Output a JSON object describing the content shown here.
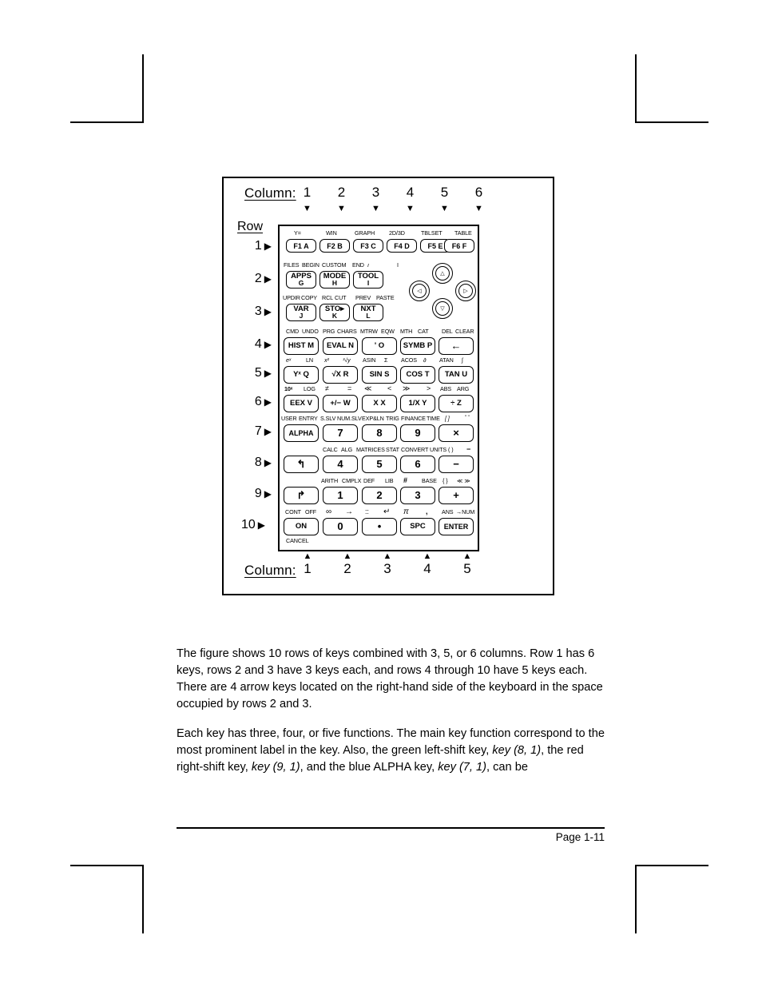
{
  "page": {
    "footer_rule": true,
    "page_number": "Page 1-11"
  },
  "figure": {
    "column_header_label": "Column:",
    "row_header_label": "Row",
    "top_columns": [
      "1",
      "2",
      "3",
      "4",
      "5",
      "6"
    ],
    "bottom_columns": [
      "1",
      "2",
      "3",
      "4",
      "5"
    ],
    "down_arrow_glyph": "▼",
    "up_arrow_glyph": "▲",
    "row_arrow_glyph": "▶",
    "rows": [
      "1",
      "2",
      "3",
      "4",
      "5",
      "6",
      "7",
      "8",
      "9",
      "10"
    ]
  },
  "keyboard": {
    "row1": {
      "top_labels": [
        "Y=",
        "WIN",
        "GRAPH",
        "2D/3D",
        "TBLSET",
        "TABLE"
      ],
      "keys": [
        "F1 A",
        "F2 B",
        "F3 C",
        "F4 D",
        "F5 E",
        "F6 F"
      ]
    },
    "row2": {
      "top_labels": [
        "FILES",
        "BEGIN",
        "CUSTOM",
        "END",
        "ı",
        "I"
      ],
      "keys": [
        {
          "main": "APPS",
          "sub": "G"
        },
        {
          "main": "MODE",
          "sub": "H"
        },
        {
          "main": "TOOL",
          "sub": "I"
        }
      ]
    },
    "row3": {
      "top_labels": [
        "UPDIR",
        "COPY",
        "RCL",
        "CUT",
        "PREV",
        "PASTE"
      ],
      "keys": [
        {
          "main": "VAR",
          "sub": "J"
        },
        {
          "main": "STO▸",
          "sub": "K"
        },
        {
          "main": "NXT",
          "sub": "L"
        }
      ]
    },
    "row4": {
      "top_labels": [
        "CMD",
        "UNDO",
        "PRG",
        "CHARS",
        "MTRW",
        "EQW",
        "MTH",
        "CAT",
        "DEL",
        "CLEAR"
      ],
      "keys": [
        "HIST M",
        "EVAL N",
        "' O",
        "SYMB P",
        "←"
      ]
    },
    "row5": {
      "top_labels": [
        "eˣ",
        "LN",
        "x²",
        "³√y",
        "ASIN",
        "Σ",
        "ACOS",
        "∂",
        "ATAN",
        "∫"
      ],
      "keys": [
        "Yˣ Q",
        "√X R",
        "SIN S",
        "COS T",
        "TAN U"
      ]
    },
    "row6": {
      "top_labels": [
        "10ˣ",
        "LOG",
        "≠",
        "=",
        "≪",
        "<",
        "≫",
        ">",
        "ABS",
        "ARG"
      ],
      "keys": [
        "EEX V",
        "+/− W",
        "X X",
        "1/X Y",
        "÷ Z"
      ]
    },
    "row7": {
      "top_labels": [
        "USER",
        "ENTRY",
        "S.SLV",
        "NUM.SLV",
        "EXP&LN",
        "TRIG",
        "FINANCE",
        "TIME",
        "[ ]",
        "\" \""
      ],
      "keys": [
        "ALPHA",
        "7",
        "8",
        "9",
        "×"
      ]
    },
    "row8": {
      "top_labels": [
        "CALC",
        "ALG",
        "MATRICES",
        "STAT",
        "CONVERT",
        "UNITS",
        "( )",
        "−"
      ],
      "keys": [
        "↰",
        "4",
        "5",
        "6",
        "−"
      ]
    },
    "row9": {
      "top_labels": [
        "ARITH",
        "CMPLX",
        "DEF",
        "LIB",
        "#",
        "BASE",
        "{ }",
        "≪ ≫"
      ],
      "keys": [
        "↱",
        "1",
        "2",
        "3",
        "+"
      ]
    },
    "row10": {
      "top_labels": [
        "CONT",
        "OFF",
        "∞",
        "→",
        "::",
        "↵",
        "π",
        ",",
        "ANS",
        "→NUM"
      ],
      "keys": [
        "ON",
        "0",
        "•",
        "SPC",
        "ENTER"
      ],
      "bottom_label": "CANCEL"
    },
    "arrow_pad": {
      "up": "△",
      "down": "▽",
      "left": "◁",
      "right": "▷"
    }
  },
  "body": {
    "paragraph1_part1": "The figure shows 10 rows of keys combined with 3, 5, or 6 columns.   Row 1 has 6 keys, rows 2 and 3 have 3 keys each, and rows 4 through 10 have 5 keys each.  There are 4 arrow keys located on the right-hand side of the keyboard in the space occupied by rows 2 and 3.",
    "paragraph2_seg1": "Each key has three, four, or five functions.  The main key function correspond to the most prominent label in the key.   Also, the green left-shift key, ",
    "paragraph2_em1": "key (8, 1)",
    "paragraph2_seg2": ", the red right-shift key, ",
    "paragraph2_em2": "key (9, 1)",
    "paragraph2_seg3": ", and the blue ALPHA  key, ",
    "paragraph2_em3": "key (7, 1)",
    "paragraph2_seg4": ", can be"
  }
}
